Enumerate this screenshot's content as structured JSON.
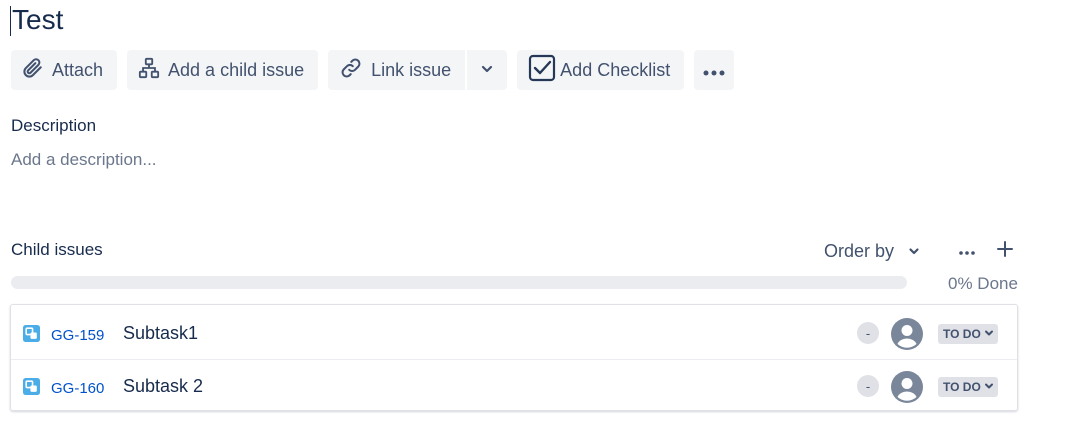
{
  "issue": {
    "title": "Test"
  },
  "toolbar": {
    "attach_label": "Attach",
    "add_child_label": "Add a child issue",
    "link_label": "Link issue",
    "checklist_label": "Add Checklist"
  },
  "description": {
    "label": "Description",
    "placeholder": "Add a description..."
  },
  "child_issues": {
    "label": "Child issues",
    "order_by_label": "Order by",
    "progress_percent": 0,
    "done_text": "0% Done",
    "items": [
      {
        "key": "GG-159",
        "summary": "Subtask1",
        "priority": "-",
        "status": "TO DO",
        "type_icon": "subtask-icon"
      },
      {
        "key": "GG-160",
        "summary": "Subtask 2",
        "priority": "-",
        "status": "TO DO",
        "type_icon": "subtask-icon"
      }
    ]
  },
  "colors": {
    "text": "#172b4d",
    "link": "#0052cc",
    "button_bg": "#f4f5f7",
    "subtask_icon": "#4bade8"
  }
}
